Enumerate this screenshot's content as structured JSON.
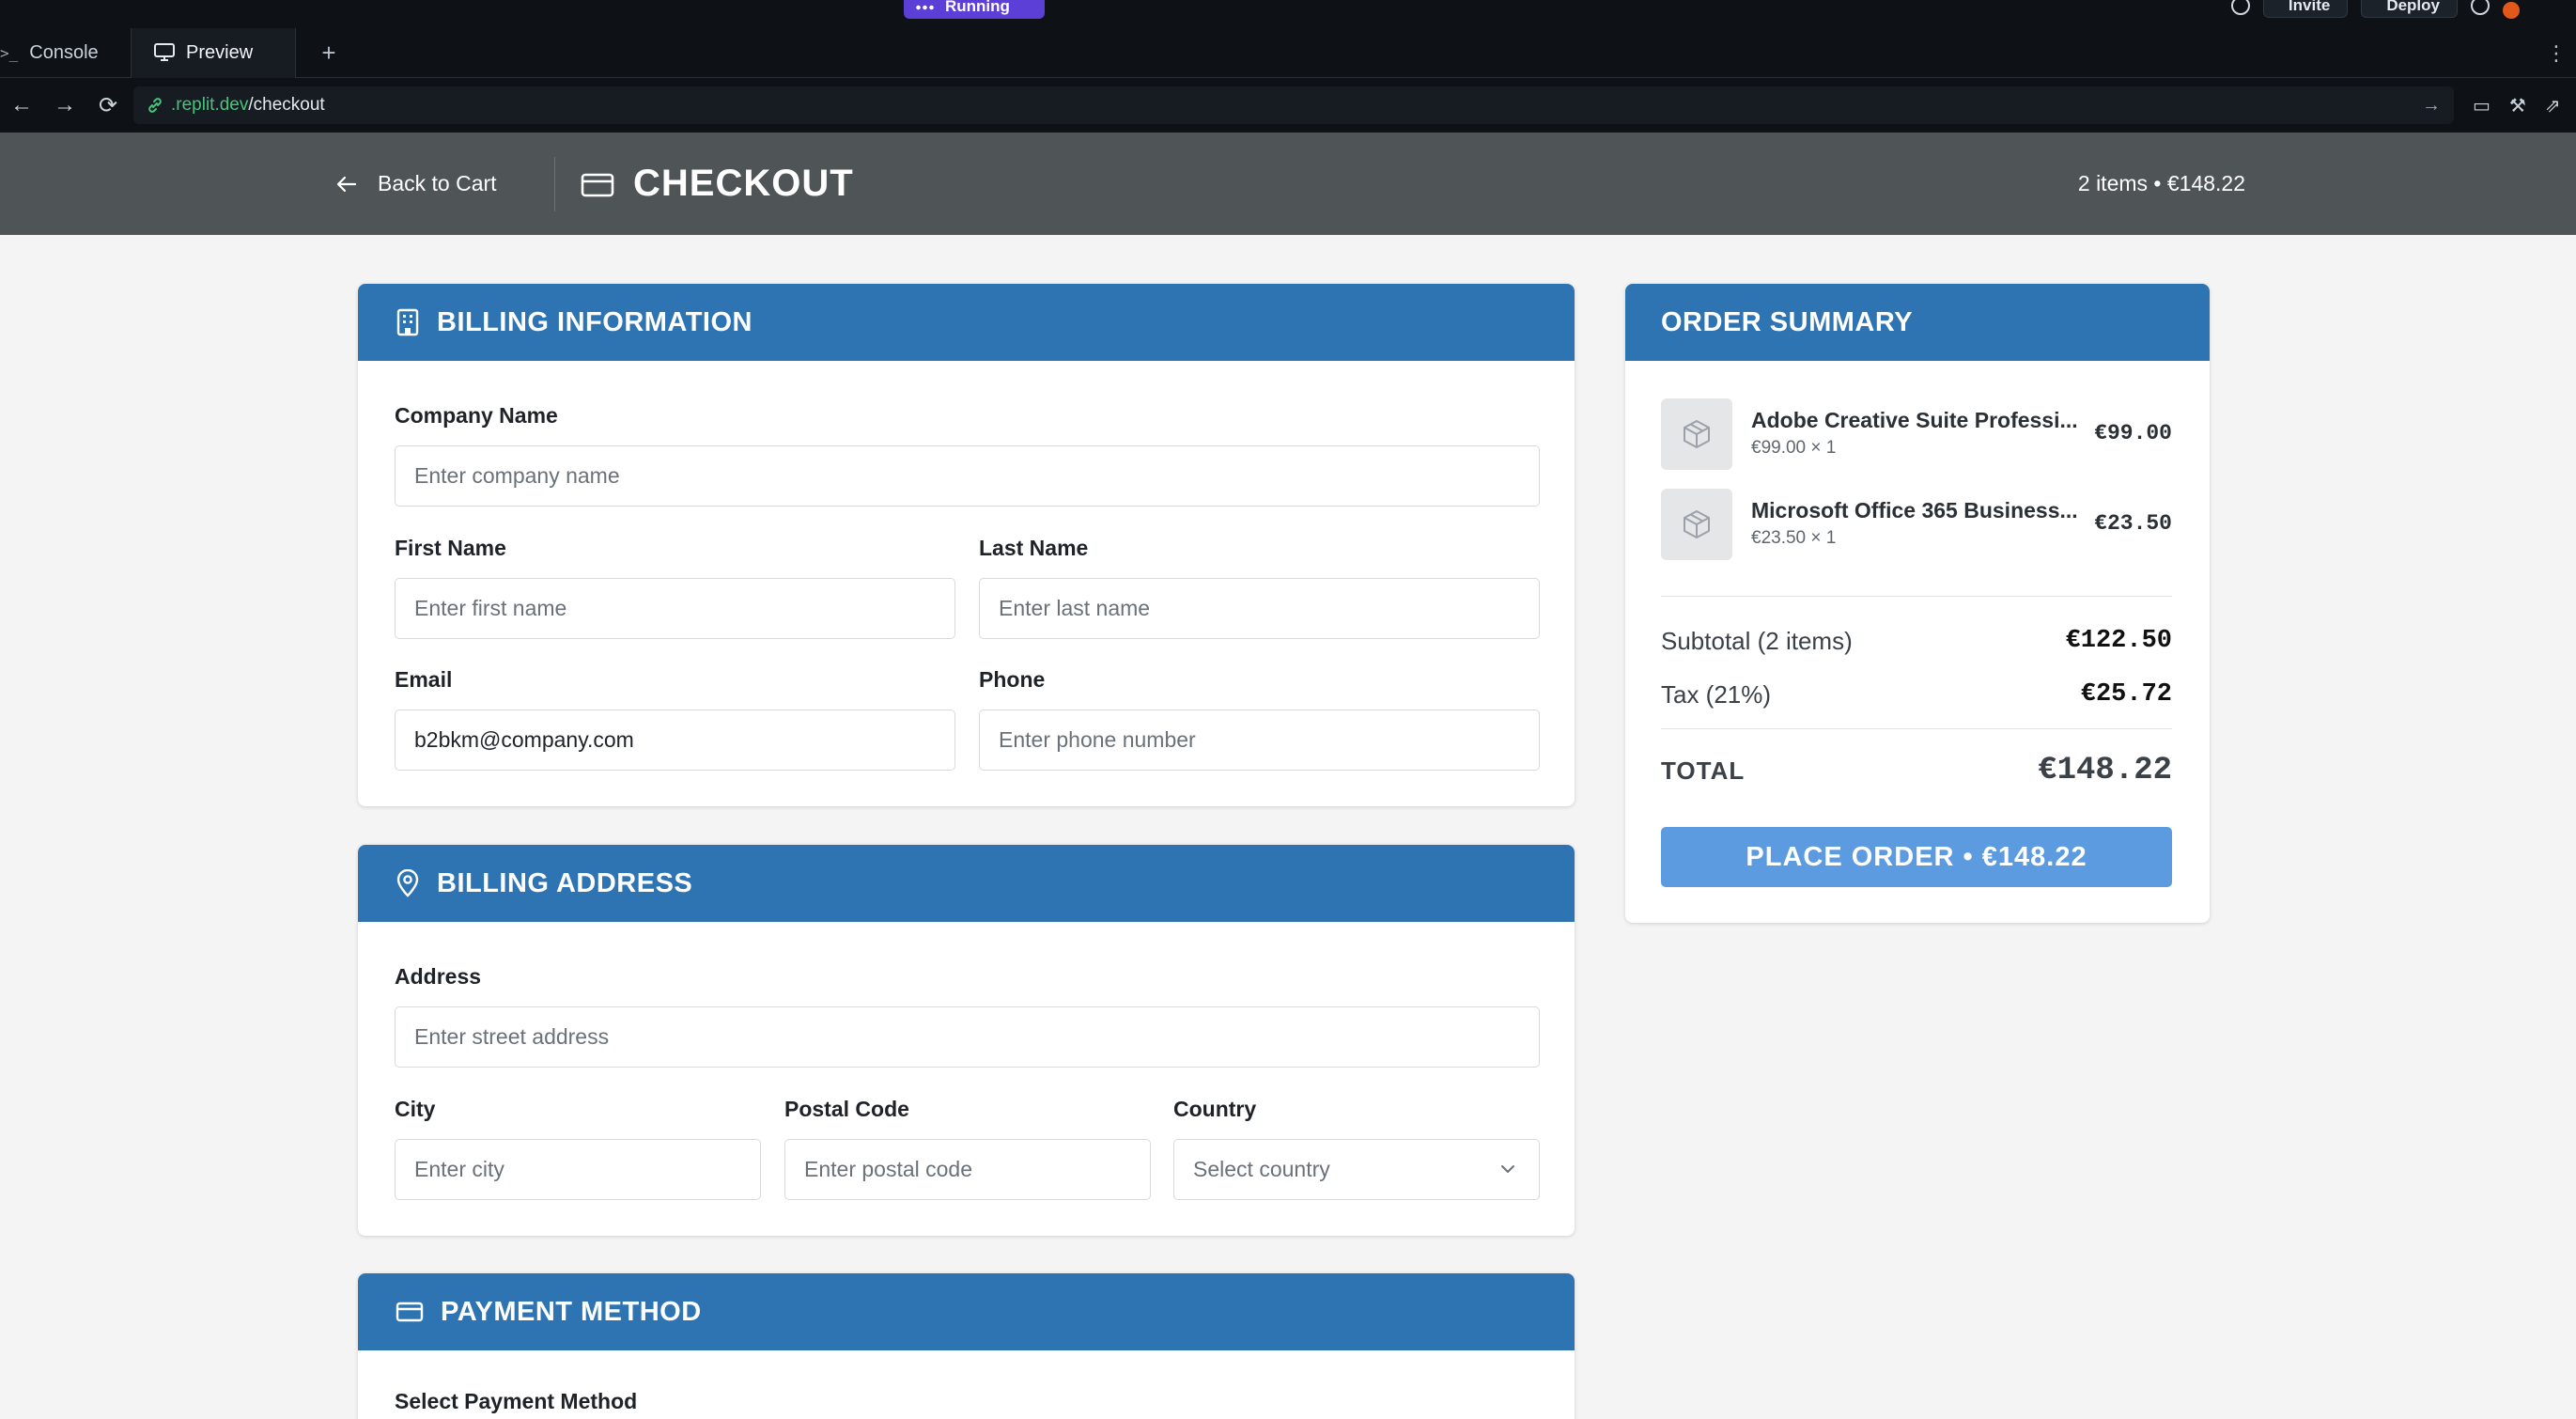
{
  "ide": {
    "run_status": "Running",
    "invite_label": "Invite",
    "deploy_label": "Deploy",
    "tabs": [
      {
        "label": "Console",
        "glyph": ">_"
      },
      {
        "label": "Preview"
      }
    ],
    "add_tab": "+",
    "more": "⋮",
    "url": {
      "host": ".replit.dev",
      "path": "/checkout"
    }
  },
  "header": {
    "back_label": "Back to Cart",
    "title": "CHECKOUT",
    "summary": "2 items • €148.22"
  },
  "billing_info": {
    "title": "BILLING INFORMATION",
    "company": {
      "label": "Company Name",
      "placeholder": "Enter company name",
      "value": ""
    },
    "first_name": {
      "label": "First Name",
      "placeholder": "Enter first name",
      "value": ""
    },
    "last_name": {
      "label": "Last Name",
      "placeholder": "Enter last name",
      "value": ""
    },
    "email": {
      "label": "Email",
      "placeholder": "",
      "value": "b2bkm@company.com"
    },
    "phone": {
      "label": "Phone",
      "placeholder": "Enter phone number",
      "value": ""
    }
  },
  "billing_address": {
    "title": "BILLING ADDRESS",
    "address": {
      "label": "Address",
      "placeholder": "Enter street address"
    },
    "city": {
      "label": "City",
      "placeholder": "Enter city"
    },
    "postal": {
      "label": "Postal Code",
      "placeholder": "Enter postal code"
    },
    "country": {
      "label": "Country",
      "selected": "Select country"
    }
  },
  "payment": {
    "title": "PAYMENT METHOD",
    "select_label": "Select Payment Method"
  },
  "order_summary": {
    "title": "ORDER SUMMARY",
    "items": [
      {
        "name": "Adobe Creative Suite Professi...",
        "meta": "€99.00 × 1",
        "price": "€99.00"
      },
      {
        "name": "Microsoft Office 365 Business...",
        "meta": "€23.50 × 1",
        "price": "€23.50"
      }
    ],
    "subtotal_label": "Subtotal (2 items)",
    "subtotal_value": "€122.50",
    "tax_label": "Tax (21%)",
    "tax_value": "€25.72",
    "total_label": "TOTAL",
    "total_value": "€148.22",
    "place_order_label": "PLACE ORDER • €148.22"
  },
  "colors": {
    "accent": "#2f74b2",
    "header_bg": "#4f5556",
    "place_order_bg": "#5d9be0",
    "ide_bg": "#0e1217",
    "run_pill": "#5b3fd6"
  }
}
